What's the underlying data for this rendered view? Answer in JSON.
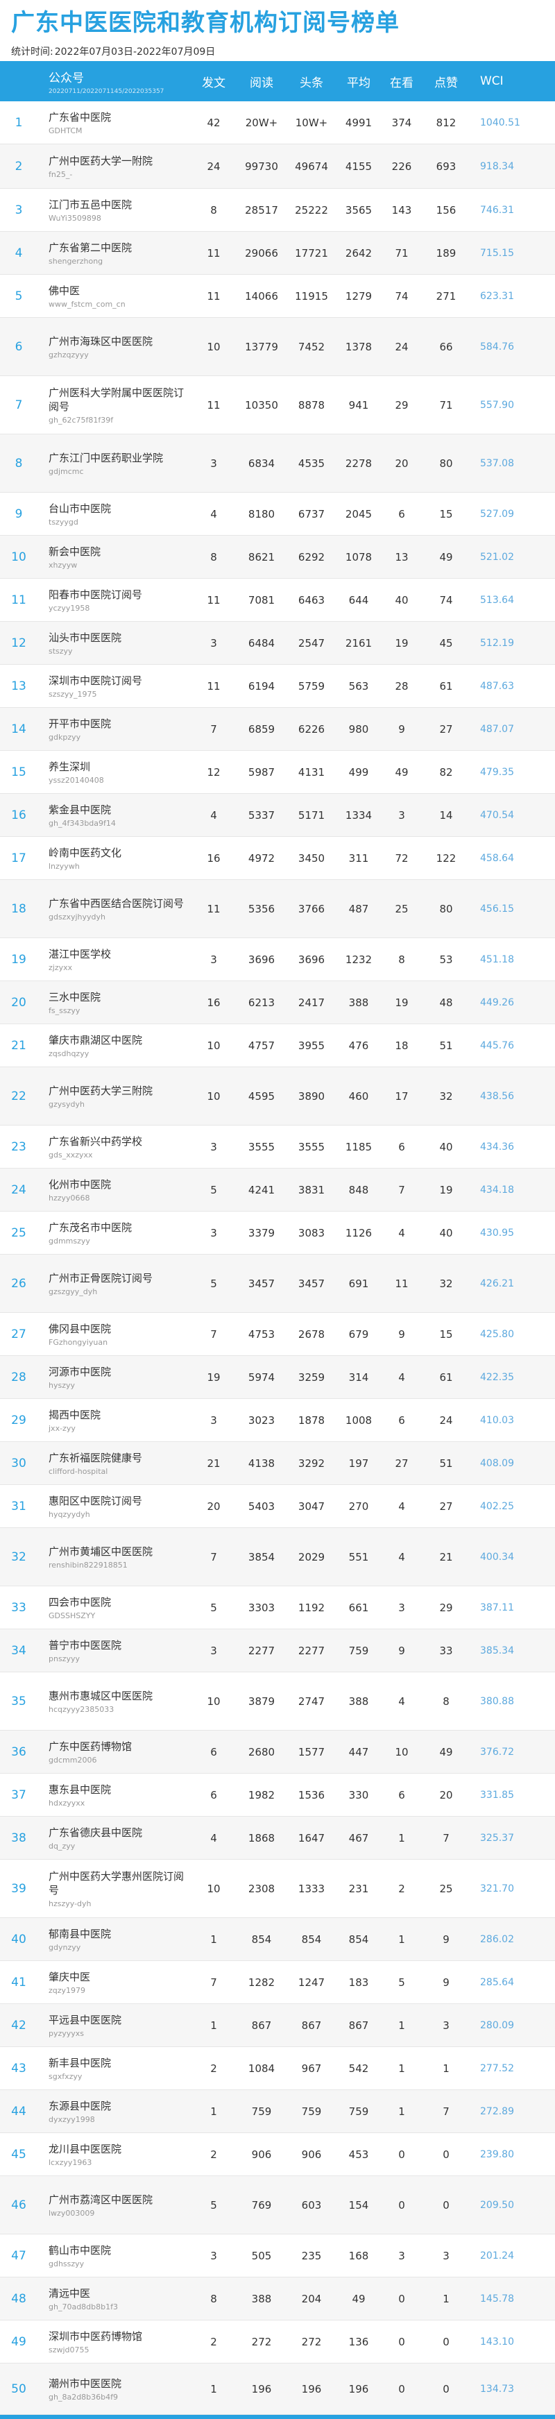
{
  "title": "广东中医医院和教育机构订阅号榜单",
  "period_label": "统计时间:",
  "period": "2022年07月03日-2022年07月09日",
  "columns": {
    "name": "公众号",
    "name_sub": "20220711/2022071145/2022035357",
    "posts": "发文",
    "read": "阅读",
    "top": "头条",
    "avg": "平均",
    "look": "在看",
    "like": "点赞",
    "wci": "WCI"
  },
  "rows": [
    {
      "rank": "1",
      "name": "广东省中医院",
      "id": "GDHTCM",
      "posts": "42",
      "read": "20W+",
      "top": "10W+",
      "avg": "4991",
      "look": "374",
      "like": "812",
      "wci": "1040.51",
      "h": 60
    },
    {
      "rank": "2",
      "name": "广州中医药大学一附院",
      "id": "fn25_-",
      "posts": "24",
      "read": "99730",
      "top": "49674",
      "avg": "4155",
      "look": "226",
      "like": "693",
      "wci": "918.34",
      "h": 62
    },
    {
      "rank": "3",
      "name": "江门市五邑中医院",
      "id": "WuYi3509898",
      "posts": "8",
      "read": "28517",
      "top": "25222",
      "avg": "3565",
      "look": "143",
      "like": "156",
      "wci": "746.31",
      "h": 60
    },
    {
      "rank": "4",
      "name": "广东省第二中医院",
      "id": "shengerzhong",
      "posts": "11",
      "read": "29066",
      "top": "17721",
      "avg": "2642",
      "look": "71",
      "like": "189",
      "wci": "715.15",
      "h": 60
    },
    {
      "rank": "5",
      "name": "佛中医",
      "id": "www_fstcm_com_cn",
      "posts": "11",
      "read": "14066",
      "top": "11915",
      "avg": "1279",
      "look": "74",
      "like": "271",
      "wci": "623.31",
      "h": 60
    },
    {
      "rank": "6",
      "name": "广州市海珠区中医医院",
      "id": "gzhzqzyyy",
      "posts": "10",
      "read": "13779",
      "top": "7452",
      "avg": "1378",
      "look": "24",
      "like": "66",
      "wci": "584.76",
      "h": 82
    },
    {
      "rank": "7",
      "name": "广州医科大学附属中医医院订阅号",
      "id": "gh_62c75f81f39f",
      "posts": "11",
      "read": "10350",
      "top": "8878",
      "avg": "941",
      "look": "29",
      "like": "71",
      "wci": "557.90",
      "h": 82
    },
    {
      "rank": "8",
      "name": "广东江门中医药职业学院",
      "id": "gdjmcmc",
      "posts": "3",
      "read": "6834",
      "top": "4535",
      "avg": "2278",
      "look": "20",
      "like": "80",
      "wci": "537.08",
      "h": 82
    },
    {
      "rank": "9",
      "name": "台山市中医院",
      "id": "tszyygd",
      "posts": "4",
      "read": "8180",
      "top": "6737",
      "avg": "2045",
      "look": "6",
      "like": "15",
      "wci": "527.09",
      "h": 60
    },
    {
      "rank": "10",
      "name": "新会中医院",
      "id": "xhzyyw",
      "posts": "8",
      "read": "8621",
      "top": "6292",
      "avg": "1078",
      "look": "13",
      "like": "49",
      "wci": "521.02",
      "h": 60
    },
    {
      "rank": "11",
      "name": "阳春市中医院订阅号",
      "id": "yczyy1958",
      "posts": "11",
      "read": "7081",
      "top": "6463",
      "avg": "644",
      "look": "40",
      "like": "74",
      "wci": "513.64",
      "h": 60
    },
    {
      "rank": "12",
      "name": "汕头市中医医院",
      "id": "stszyy",
      "posts": "3",
      "read": "6484",
      "top": "2547",
      "avg": "2161",
      "look": "19",
      "like": "45",
      "wci": "512.19",
      "h": 60
    },
    {
      "rank": "13",
      "name": "深圳市中医院订阅号",
      "id": "szszyy_1975",
      "posts": "11",
      "read": "6194",
      "top": "5759",
      "avg": "563",
      "look": "28",
      "like": "61",
      "wci": "487.63",
      "h": 60
    },
    {
      "rank": "14",
      "name": "开平市中医院",
      "id": "gdkpzyy",
      "posts": "7",
      "read": "6859",
      "top": "6226",
      "avg": "980",
      "look": "9",
      "like": "27",
      "wci": "487.07",
      "h": 60
    },
    {
      "rank": "15",
      "name": "养生深圳",
      "id": "yssz20140408",
      "posts": "12",
      "read": "5987",
      "top": "4131",
      "avg": "499",
      "look": "49",
      "like": "82",
      "wci": "479.35",
      "h": 60
    },
    {
      "rank": "16",
      "name": "紫金县中医院",
      "id": "gh_4f343bda9f14",
      "posts": "4",
      "read": "5337",
      "top": "5171",
      "avg": "1334",
      "look": "3",
      "like": "14",
      "wci": "470.54",
      "h": 60
    },
    {
      "rank": "17",
      "name": "岭南中医药文化",
      "id": "lnzyywh",
      "posts": "16",
      "read": "4972",
      "top": "3450",
      "avg": "311",
      "look": "72",
      "like": "122",
      "wci": "458.64",
      "h": 60
    },
    {
      "rank": "18",
      "name": "广东省中西医结合医院订阅号",
      "id": "gdszxyjhyydyh",
      "posts": "11",
      "read": "5356",
      "top": "3766",
      "avg": "487",
      "look": "25",
      "like": "80",
      "wci": "456.15",
      "h": 82
    },
    {
      "rank": "19",
      "name": "湛江中医学校",
      "id": "zjzyxx",
      "posts": "3",
      "read": "3696",
      "top": "3696",
      "avg": "1232",
      "look": "8",
      "like": "53",
      "wci": "451.18",
      "h": 60
    },
    {
      "rank": "20",
      "name": "三水中医院",
      "id": "fs_sszyy",
      "posts": "16",
      "read": "6213",
      "top": "2417",
      "avg": "388",
      "look": "19",
      "like": "48",
      "wci": "449.26",
      "h": 60
    },
    {
      "rank": "21",
      "name": "肇庆市鼎湖区中医院",
      "id": "zqsdhqzyy",
      "posts": "10",
      "read": "4757",
      "top": "3955",
      "avg": "476",
      "look": "18",
      "like": "51",
      "wci": "445.76",
      "h": 60
    },
    {
      "rank": "22",
      "name": "广州中医药大学三附院",
      "id": "gzysydyh",
      "posts": "10",
      "read": "4595",
      "top": "3890",
      "avg": "460",
      "look": "17",
      "like": "32",
      "wci": "438.56",
      "h": 82
    },
    {
      "rank": "23",
      "name": "广东省新兴中药学校",
      "id": "gds_xxzyxx",
      "posts": "3",
      "read": "3555",
      "top": "3555",
      "avg": "1185",
      "look": "6",
      "like": "40",
      "wci": "434.36",
      "h": 60
    },
    {
      "rank": "24",
      "name": "化州市中医院",
      "id": "hzzyy0668",
      "posts": "5",
      "read": "4241",
      "top": "3831",
      "avg": "848",
      "look": "7",
      "like": "19",
      "wci": "434.18",
      "h": 60
    },
    {
      "rank": "25",
      "name": "广东茂名市中医院",
      "id": "gdmmszyy",
      "posts": "3",
      "read": "3379",
      "top": "3083",
      "avg": "1126",
      "look": "4",
      "like": "40",
      "wci": "430.95",
      "h": 60
    },
    {
      "rank": "26",
      "name": "广州市正骨医院订阅号",
      "id": "gzszgyy_dyh",
      "posts": "5",
      "read": "3457",
      "top": "3457",
      "avg": "691",
      "look": "11",
      "like": "32",
      "wci": "426.21",
      "h": 82
    },
    {
      "rank": "27",
      "name": "佛冈县中医院",
      "id": "FGzhongyiyuan",
      "posts": "7",
      "read": "4753",
      "top": "2678",
      "avg": "679",
      "look": "9",
      "like": "15",
      "wci": "425.80",
      "h": 60
    },
    {
      "rank": "28",
      "name": "河源市中医院",
      "id": "hyszyy",
      "posts": "19",
      "read": "5974",
      "top": "3259",
      "avg": "314",
      "look": "4",
      "like": "61",
      "wci": "422.35",
      "h": 60
    },
    {
      "rank": "29",
      "name": "揭西中医院",
      "id": "jxx-zyy",
      "posts": "3",
      "read": "3023",
      "top": "1878",
      "avg": "1008",
      "look": "6",
      "like": "24",
      "wci": "410.03",
      "h": 60
    },
    {
      "rank": "30",
      "name": "广东祈福医院健康号",
      "id": "clifford-hospital",
      "posts": "21",
      "read": "4138",
      "top": "3292",
      "avg": "197",
      "look": "27",
      "like": "51",
      "wci": "408.09",
      "h": 60
    },
    {
      "rank": "31",
      "name": "惠阳区中医院订阅号",
      "id": "hyqzyydyh",
      "posts": "20",
      "read": "5403",
      "top": "3047",
      "avg": "270",
      "look": "4",
      "like": "27",
      "wci": "402.25",
      "h": 60
    },
    {
      "rank": "32",
      "name": "广州市黄埔区中医医院",
      "id": "renshibin822918851",
      "posts": "7",
      "read": "3854",
      "top": "2029",
      "avg": "551",
      "look": "4",
      "like": "21",
      "wci": "400.34",
      "h": 82
    },
    {
      "rank": "33",
      "name": "四会市中医院",
      "id": "GDSSHSZYY",
      "posts": "5",
      "read": "3303",
      "top": "1192",
      "avg": "661",
      "look": "3",
      "like": "29",
      "wci": "387.11",
      "h": 60
    },
    {
      "rank": "34",
      "name": "普宁市中医医院",
      "id": "pnszyyy",
      "posts": "3",
      "read": "2277",
      "top": "2277",
      "avg": "759",
      "look": "9",
      "like": "33",
      "wci": "385.34",
      "h": 60
    },
    {
      "rank": "35",
      "name": "惠州市惠城区中医医院",
      "id": "hcqzyyy2385033",
      "posts": "10",
      "read": "3879",
      "top": "2747",
      "avg": "388",
      "look": "4",
      "like": "8",
      "wci": "380.88",
      "h": 82
    },
    {
      "rank": "36",
      "name": "广东中医药博物馆",
      "id": "gdcmm2006",
      "posts": "6",
      "read": "2680",
      "top": "1577",
      "avg": "447",
      "look": "10",
      "like": "49",
      "wci": "376.72",
      "h": 60
    },
    {
      "rank": "37",
      "name": "惠东县中医院",
      "id": "hdxzyyxx",
      "posts": "6",
      "read": "1982",
      "top": "1536",
      "avg": "330",
      "look": "6",
      "like": "20",
      "wci": "331.85",
      "h": 60
    },
    {
      "rank": "38",
      "name": "广东省德庆县中医院",
      "id": "dq_zyy",
      "posts": "4",
      "read": "1868",
      "top": "1647",
      "avg": "467",
      "look": "1",
      "like": "7",
      "wci": "325.37",
      "h": 60
    },
    {
      "rank": "39",
      "name": "广州中医药大学惠州医院订阅号",
      "id": "hzszyy-dyh",
      "posts": "10",
      "read": "2308",
      "top": "1333",
      "avg": "231",
      "look": "2",
      "like": "25",
      "wci": "321.70",
      "h": 82
    },
    {
      "rank": "40",
      "name": "郁南县中医院",
      "id": "gdynzyy",
      "posts": "1",
      "read": "854",
      "top": "854",
      "avg": "854",
      "look": "1",
      "like": "9",
      "wci": "286.02",
      "h": 60
    },
    {
      "rank": "41",
      "name": "肇庆中医",
      "id": "zqzy1979",
      "posts": "7",
      "read": "1282",
      "top": "1247",
      "avg": "183",
      "look": "5",
      "like": "9",
      "wci": "285.64",
      "h": 60
    },
    {
      "rank": "42",
      "name": "平远县中医医院",
      "id": "pyzyyyxs",
      "posts": "1",
      "read": "867",
      "top": "867",
      "avg": "867",
      "look": "1",
      "like": "3",
      "wci": "280.09",
      "h": 60
    },
    {
      "rank": "43",
      "name": "新丰县中医院",
      "id": "sgxfxzyy",
      "posts": "2",
      "read": "1084",
      "top": "967",
      "avg": "542",
      "look": "1",
      "like": "1",
      "wci": "277.52",
      "h": 60
    },
    {
      "rank": "44",
      "name": "东源县中医院",
      "id": "dyxzyy1998",
      "posts": "1",
      "read": "759",
      "top": "759",
      "avg": "759",
      "look": "1",
      "like": "7",
      "wci": "272.89",
      "h": 60
    },
    {
      "rank": "45",
      "name": "龙川县中医医院",
      "id": "lcxzyy1963",
      "posts": "2",
      "read": "906",
      "top": "906",
      "avg": "453",
      "look": "0",
      "like": "0",
      "wci": "239.80",
      "h": 60
    },
    {
      "rank": "46",
      "name": "广州市荔湾区中医医院",
      "id": "lwzy003009",
      "posts": "5",
      "read": "769",
      "top": "603",
      "avg": "154",
      "look": "0",
      "like": "0",
      "wci": "209.50",
      "h": 82
    },
    {
      "rank": "47",
      "name": "鹤山市中医院",
      "id": "gdhsszyy",
      "posts": "3",
      "read": "505",
      "top": "235",
      "avg": "168",
      "look": "3",
      "like": "3",
      "wci": "201.24",
      "h": 60
    },
    {
      "rank": "48",
      "name": "清远中医",
      "id": "gh_70ad8db8b1f3",
      "posts": "8",
      "read": "388",
      "top": "204",
      "avg": "49",
      "look": "0",
      "like": "1",
      "wci": "145.78",
      "h": 60
    },
    {
      "rank": "49",
      "name": "深圳市中医药博物馆",
      "id": "szwjd0755",
      "posts": "2",
      "read": "272",
      "top": "272",
      "avg": "136",
      "look": "0",
      "like": "0",
      "wci": "143.10",
      "h": 60
    },
    {
      "rank": "50",
      "name": "潮州市中医医院",
      "id": "gh_8a2d8b36b4f9",
      "posts": "1",
      "read": "196",
      "top": "196",
      "avg": "196",
      "look": "0",
      "like": "0",
      "wci": "134.73",
      "h": 60
    }
  ]
}
